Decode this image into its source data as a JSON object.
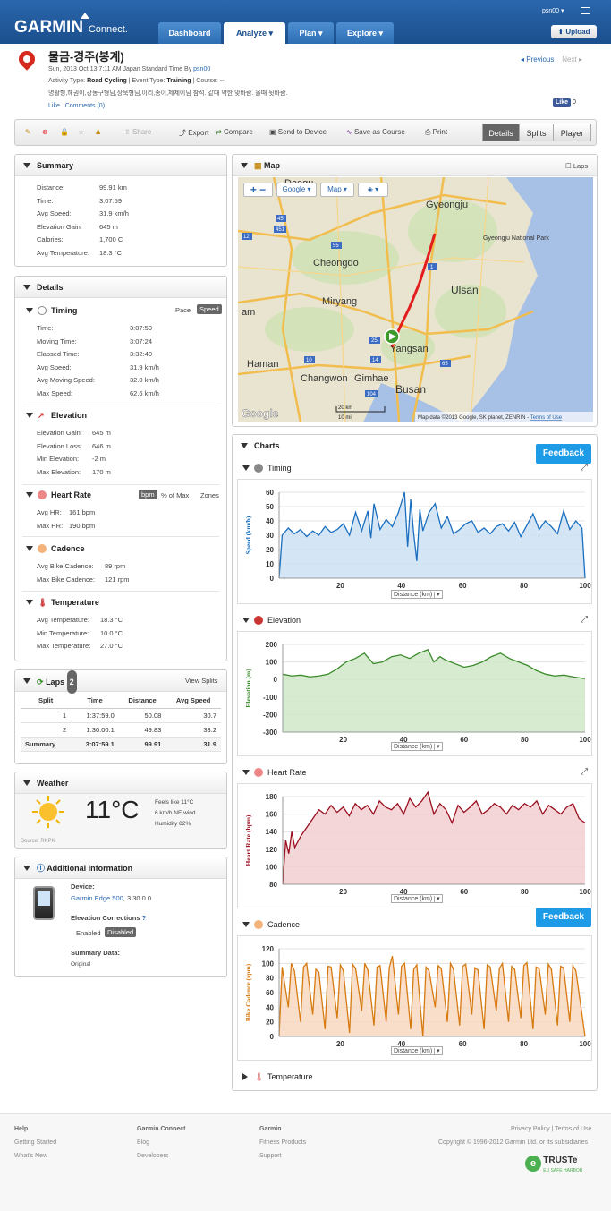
{
  "header": {
    "logo": "GARMIN",
    "logo_sub": "Connect.",
    "nav": [
      "Dashboard",
      "Analyze",
      "Plan",
      "Explore"
    ],
    "user": "psn00",
    "upload": "Upload"
  },
  "activity": {
    "title": "물금-경주(봉계)",
    "date": "Sun, 2013 Oct 13 7:11 AM Japan Standard Time By",
    "owner": "psn00",
    "type_label": "Activity Type:",
    "type": "Road Cycling",
    "event_label": "Event Type:",
    "event": "Training",
    "course_label": "Course:",
    "course": "--",
    "desc": "명활형,해권이,강동구형님,상욱형님,이리,종이,제제이님 참석. 같때 약한 맞바람. 올때 뒷바람.",
    "like": "Like",
    "comments": "Comments (0)",
    "prev": "Previous",
    "next": "Next",
    "fb_like": "Like",
    "fb_count": "0"
  },
  "toolbar": {
    "share": "Share",
    "export": "Export",
    "compare": "Compare",
    "send": "Send to Device",
    "save_course": "Save as Course",
    "print": "Print",
    "details": "Details",
    "splits": "Splits",
    "player": "Player"
  },
  "summary": {
    "title": "Summary",
    "rows": [
      [
        "Distance:",
        "99.91 km"
      ],
      [
        "Time:",
        "3:07:59"
      ],
      [
        "Avg Speed:",
        "31.9 km/h"
      ],
      [
        "Elevation Gain:",
        "645 m"
      ],
      [
        "Calories:",
        "1,700 C"
      ],
      [
        "Avg Temperature:",
        "18.3 °C"
      ]
    ]
  },
  "details": {
    "title": "Details",
    "timing": {
      "title": "Timing",
      "pace": "Pace",
      "speed": "Speed",
      "rows": [
        [
          "Time:",
          "3:07:59"
        ],
        [
          "Moving Time:",
          "3:07:24"
        ],
        [
          "Elapsed Time:",
          "3:32:40"
        ],
        [
          "Avg Speed:",
          "31.9 km/h"
        ],
        [
          "Avg Moving Speed:",
          "32.0 km/h"
        ],
        [
          "Max Speed:",
          "62.6 km/h"
        ]
      ]
    },
    "elevation": {
      "title": "Elevation",
      "rows": [
        [
          "Elevation Gain:",
          "645 m"
        ],
        [
          "Elevation Loss:",
          "646 m"
        ],
        [
          "Min Elevation:",
          "-2 m"
        ],
        [
          "Max Elevation:",
          "170 m"
        ]
      ]
    },
    "hr": {
      "title": "Heart Rate",
      "bpm": "bpm",
      "max": "% of Max",
      "zones": "Zones",
      "rows": [
        [
          "Avg HR:",
          "161 bpm"
        ],
        [
          "Max HR:",
          "190 bpm"
        ]
      ]
    },
    "cadence": {
      "title": "Cadence",
      "rows": [
        [
          "Avg Bike Cadence:",
          "89 rpm"
        ],
        [
          "Max Bike Cadence:",
          "121 rpm"
        ]
      ]
    },
    "temp": {
      "title": "Temperature",
      "rows": [
        [
          "Avg Temperature:",
          "18.3 °C"
        ],
        [
          "Min Temperature:",
          "10.0 °C"
        ],
        [
          "Max Temperature:",
          "27.0 °C"
        ]
      ]
    }
  },
  "laps": {
    "title": "Laps",
    "count": "2",
    "view": "View Splits",
    "headers": [
      "Split",
      "Time",
      "Distance",
      "Avg Speed"
    ],
    "rows": [
      [
        "1",
        "1:37:59.0",
        "50.08",
        "30.7"
      ],
      [
        "2",
        "1:30:00.1",
        "49.83",
        "33.2"
      ]
    ],
    "summary": [
      "Summary",
      "3:07:59.1",
      "99.91",
      "31.9"
    ]
  },
  "weather": {
    "title": "Weather",
    "temp": "11°C",
    "feels": "Feels like 11°C",
    "wind": "6 km/h NE wind",
    "humidity": "Humidity 82%",
    "source": "Source: RKPK"
  },
  "info": {
    "title": "Additional Information",
    "device_label": "Device:",
    "device": "Garmin Edge 500",
    "version": ", 3.30.0.0",
    "elev_label": "Elevation Corrections",
    "enabled": "Enabled",
    "disabled": "Disabled",
    "summary_label": "Summary Data:",
    "summary_val": "Original"
  },
  "map": {
    "title": "Map",
    "laps": "Laps",
    "google": "Google",
    "map_btn": "Map",
    "labels": [
      "Daegu",
      "Gyeongju",
      "Gyeongju National Park",
      "Cheongdo",
      "Ulsan",
      "Miryang",
      "Yangsan",
      "Haman",
      "Changwon",
      "Gimhae",
      "Busan",
      "am"
    ],
    "road_numbers": [
      "45",
      "451",
      "12",
      "55",
      "1",
      "25",
      "10",
      "14",
      "65",
      "104"
    ],
    "scale_km": "20 km",
    "scale_mi": "10 mi",
    "attribution": "Map data ©2013 Google, SK planet, ZENRIN",
    "terms": "Terms of Use"
  },
  "charts": {
    "title": "Charts",
    "feedback": "Feedback",
    "distance_label": "Distance (km)",
    "temperature": "Temperature"
  },
  "chart_data": [
    {
      "type": "line",
      "title": "Timing",
      "ylabel": "Speed (km/h)",
      "xlabel": "Distance (km)",
      "xlim": [
        0,
        100
      ],
      "ylim": [
        0,
        60
      ],
      "yticks": [
        0,
        10,
        20,
        30,
        40,
        50,
        60
      ],
      "xticks": [
        20,
        40,
        60,
        80,
        100
      ],
      "color": "#1a6fc0",
      "fill": "#cde0f5",
      "x": [
        0,
        1,
        3,
        5,
        7,
        9,
        11,
        13,
        15,
        17,
        19,
        21,
        23,
        25,
        27,
        29,
        30,
        31,
        33,
        35,
        37,
        39,
        41,
        42,
        43,
        44,
        45,
        46,
        47,
        49,
        51,
        53,
        55,
        57,
        59,
        61,
        63,
        65,
        67,
        69,
        71,
        73,
        75,
        77,
        79,
        81,
        83,
        85,
        87,
        89,
        91,
        93,
        95,
        97,
        99,
        100
      ],
      "y": [
        0,
        30,
        35,
        31,
        34,
        29,
        33,
        30,
        36,
        32,
        34,
        38,
        30,
        46,
        33,
        47,
        28,
        52,
        34,
        41,
        36,
        46,
        60,
        22,
        55,
        31,
        12,
        48,
        33,
        46,
        52,
        35,
        43,
        31,
        34,
        38,
        40,
        32,
        35,
        31,
        36,
        38,
        33,
        39,
        29,
        37,
        45,
        34,
        40,
        36,
        31,
        47,
        34,
        40,
        35,
        0
      ]
    },
    {
      "type": "area",
      "title": "Elevation",
      "ylabel": "Elevation (m)",
      "xlabel": "Distance (km)",
      "xlim": [
        0,
        100
      ],
      "ylim": [
        -300,
        200
      ],
      "yticks": [
        -300,
        -200,
        -100,
        0,
        100,
        200
      ],
      "xticks": [
        20,
        40,
        60,
        80,
        100
      ],
      "color": "#3a8a2a",
      "fill": "#d0e8c8",
      "x": [
        0,
        3,
        6,
        9,
        12,
        15,
        18,
        21,
        24,
        27,
        30,
        33,
        36,
        39,
        42,
        45,
        48,
        50,
        52,
        54,
        57,
        60,
        63,
        66,
        69,
        72,
        75,
        78,
        81,
        84,
        87,
        90,
        93,
        96,
        100
      ],
      "y": [
        30,
        20,
        25,
        15,
        20,
        30,
        60,
        100,
        120,
        150,
        90,
        100,
        130,
        140,
        120,
        150,
        170,
        100,
        130,
        110,
        90,
        70,
        80,
        100,
        130,
        150,
        120,
        100,
        80,
        50,
        30,
        20,
        25,
        15,
        5
      ]
    },
    {
      "type": "line",
      "title": "Heart Rate",
      "ylabel": "Heart Rate (bpm)",
      "xlabel": "Distance (km)",
      "xlim": [
        0,
        100
      ],
      "ylim": [
        80,
        180
      ],
      "yticks": [
        80,
        100,
        120,
        140,
        160,
        180
      ],
      "xticks": [
        20,
        40,
        60,
        80,
        100
      ],
      "color": "#9a0f1e",
      "fill": "#f2cfd2",
      "x": [
        0,
        1,
        2,
        3,
        4,
        6,
        8,
        10,
        12,
        14,
        16,
        18,
        20,
        22,
        24,
        26,
        28,
        30,
        32,
        34,
        36,
        38,
        40,
        42,
        44,
        46,
        48,
        50,
        52,
        54,
        56,
        58,
        60,
        62,
        64,
        66,
        68,
        70,
        72,
        74,
        76,
        78,
        80,
        82,
        84,
        86,
        88,
        90,
        92,
        94,
        96,
        98,
        100
      ],
      "y": [
        80,
        130,
        115,
        140,
        122,
        135,
        145,
        155,
        165,
        160,
        170,
        162,
        168,
        158,
        172,
        165,
        170,
        160,
        175,
        168,
        165,
        172,
        160,
        178,
        168,
        175,
        185,
        160,
        172,
        165,
        150,
        170,
        162,
        168,
        175,
        160,
        165,
        172,
        168,
        160,
        170,
        165,
        172,
        168,
        175,
        160,
        170,
        165,
        160,
        168,
        172,
        155,
        150
      ]
    },
    {
      "type": "line",
      "title": "Cadence",
      "ylabel": "Bike Cadence (rpm)",
      "xlabel": "Distance (km)",
      "xlim": [
        0,
        100
      ],
      "ylim": [
        0,
        120
      ],
      "yticks": [
        0,
        20,
        40,
        60,
        80,
        100,
        120
      ],
      "xticks": [
        20,
        40,
        60,
        80,
        100
      ],
      "color": "#d77a10",
      "fill": "#f8d8c0",
      "x": [
        0,
        1,
        3,
        4,
        5,
        7,
        8,
        9,
        11,
        12,
        13,
        15,
        16,
        17,
        19,
        20,
        21,
        23,
        24,
        25,
        27,
        28,
        29,
        31,
        32,
        33,
        35,
        36,
        37,
        39,
        40,
        41,
        43,
        44,
        45,
        47,
        48,
        49,
        51,
        52,
        53,
        55,
        56,
        57,
        59,
        60,
        61,
        63,
        64,
        65,
        67,
        68,
        69,
        71,
        72,
        73,
        75,
        76,
        77,
        79,
        80,
        81,
        83,
        84,
        85,
        87,
        88,
        89,
        91,
        92,
        93,
        95,
        96,
        97,
        99,
        100
      ],
      "y": [
        0,
        95,
        40,
        100,
        90,
        20,
        95,
        100,
        30,
        92,
        88,
        10,
        96,
        95,
        25,
        98,
        90,
        5,
        99,
        93,
        35,
        100,
        91,
        15,
        95,
        97,
        20,
        94,
        110,
        30,
        96,
        100,
        10,
        92,
        98,
        0,
        95,
        90,
        40,
        97,
        93,
        20,
        100,
        92,
        15,
        96,
        99,
        30,
        94,
        91,
        10,
        98,
        95,
        35,
        93,
        100,
        20,
        96,
        92,
        25,
        97,
        101,
        10,
        95,
        93,
        30,
        99,
        92,
        15,
        96,
        94,
        20,
        97,
        90,
        30,
        0
      ]
    }
  ],
  "footer": {
    "help": "Help",
    "getting_started": "Getting Started",
    "whats_new": "What's New",
    "gc": "Garmin Connect",
    "blog": "Blog",
    "developers": "Developers",
    "garmin": "Garmin",
    "fitness": "Fitness Products",
    "support": "Support",
    "privacy": "Privacy Policy",
    "terms": "Terms of Use",
    "copyright": "Copyright © 1996-2012 Garmin Ltd. or its subsidiaries",
    "truste": "TRUSTe",
    "truste_sub": "EU SAFE HARBOR"
  }
}
